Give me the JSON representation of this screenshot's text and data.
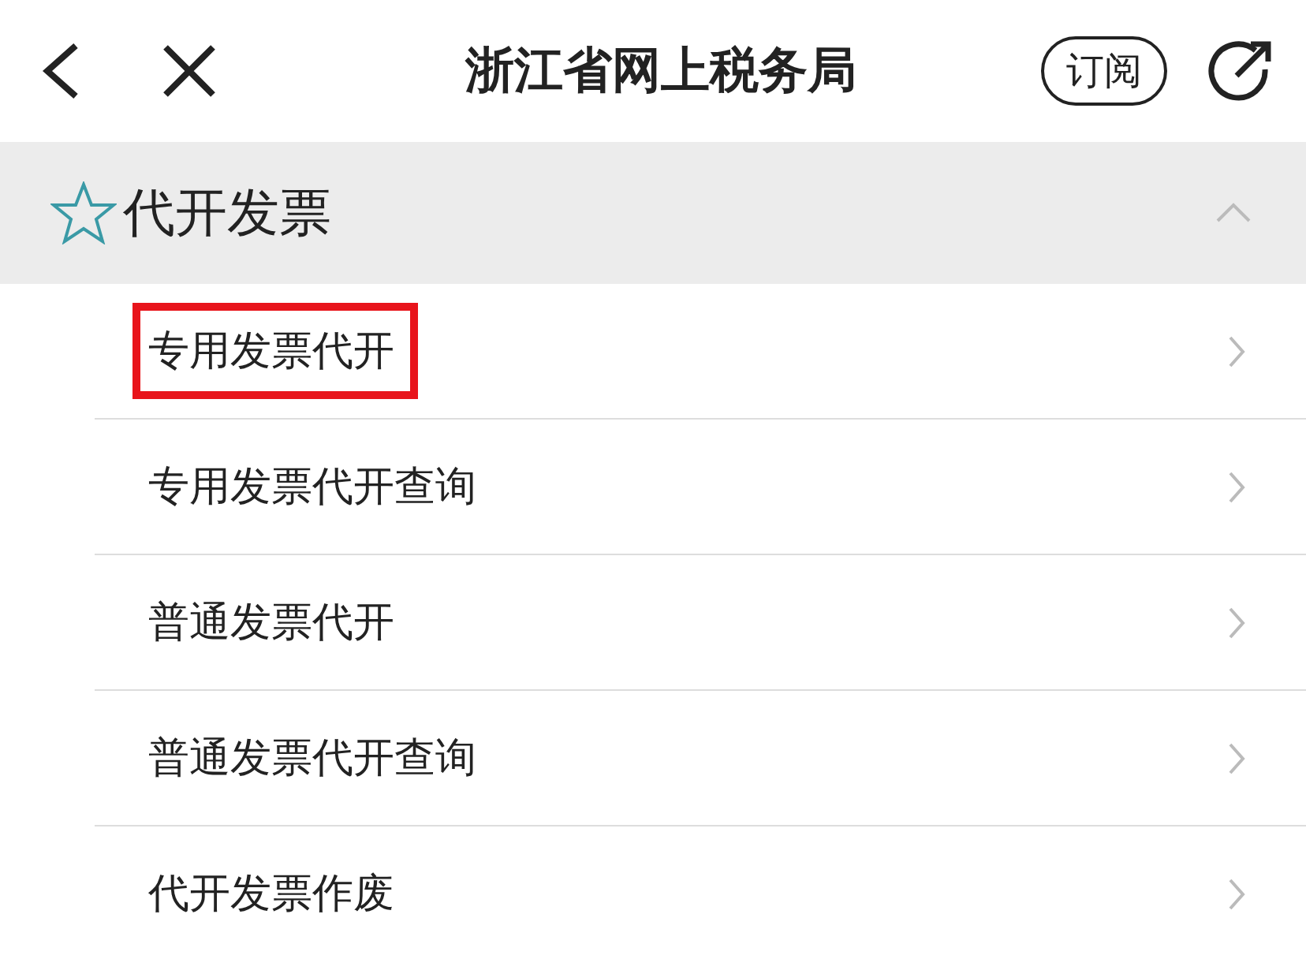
{
  "header": {
    "title": "浙江省网上税务局",
    "subscribe_button": "订阅"
  },
  "section": {
    "title": "代开发票",
    "expanded": true
  },
  "items": [
    {
      "label": "专用发票代开",
      "highlighted": true
    },
    {
      "label": "专用发票代开查询",
      "highlighted": false
    },
    {
      "label": "普通发票代开",
      "highlighted": false
    },
    {
      "label": "普通发票代开查询",
      "highlighted": false
    },
    {
      "label": "代开发票作废",
      "highlighted": false
    }
  ]
}
